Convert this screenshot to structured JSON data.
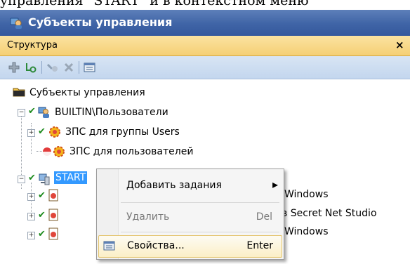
{
  "doc": {
    "text": "управления \"START\" и в контекстном меню"
  },
  "app": {
    "title": "Субъекты управления"
  },
  "panel": {
    "title": "Структура",
    "close": "×"
  },
  "toolbar": {
    "buttons": [
      "add-icon",
      "add-subject-icon",
      "link-icon",
      "delete-icon",
      "properties-icon"
    ]
  },
  "tree": {
    "root": "Субъекты управления",
    "nodes": [
      {
        "label": "BUILTIN\\Пользователи"
      },
      {
        "label": "ЗПС для группы Users"
      },
      {
        "label": "ЗПС для пользователей"
      },
      {
        "label": "START"
      },
      {
        "label": "Windows"
      },
      {
        "label": "в Secret Net Studio"
      },
      {
        "label": "Windows"
      }
    ]
  },
  "context_menu": {
    "items": [
      {
        "label": "Добавить задания",
        "shortcut": "",
        "submenu": "▸"
      },
      {
        "label": "Удалить",
        "shortcut": "Del"
      },
      {
        "label": "Свойства...",
        "shortcut": "Enter"
      }
    ]
  },
  "colors": {
    "title_bar": "#3f64a6",
    "panel_header": "#f5cf74",
    "toolbar": "#c3d6ee",
    "selection": "#3399ff"
  }
}
